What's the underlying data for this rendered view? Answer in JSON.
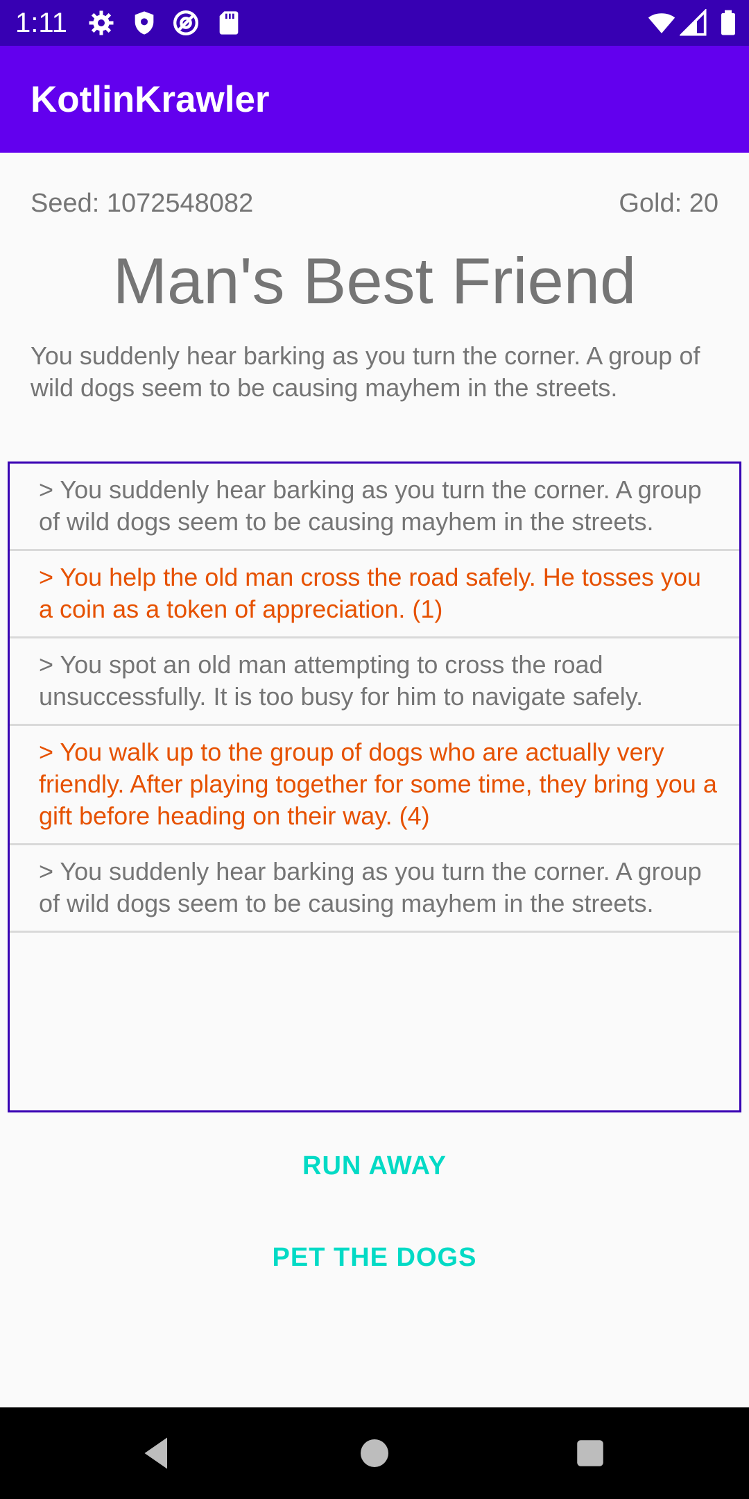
{
  "status_bar": {
    "time": "1:11",
    "icons": [
      "gear-icon",
      "shield-icon",
      "at-sign-icon",
      "sd-card-icon",
      "wifi-icon",
      "cell-signal-icon",
      "battery-icon"
    ]
  },
  "app_bar": {
    "title": "KotlinKrawler",
    "color": "#6200ee"
  },
  "header": {
    "seed": "Seed: 1072548082",
    "gold": "Gold: 20"
  },
  "event": {
    "title": "Man's Best Friend",
    "description": "You suddenly hear barking as you turn the corner. A group of wild dogs seem to be causing mayhem in the streets."
  },
  "log": [
    {
      "text": "> You suddenly hear barking as you turn the corner. A group of wild dogs seem to be causing mayhem in the streets.",
      "highlight": false
    },
    {
      "text": "> You help the old man cross the road safely. He tosses you a coin as a token of appreciation. (1)",
      "highlight": true
    },
    {
      "text": "> You spot an old man attempting to cross the road unsuccessfully. It is too busy for him to navigate safely.",
      "highlight": false
    },
    {
      "text": "> You walk up to the group of dogs who are actually very friendly. After playing together for some time, they bring you a gift before heading on their way. (4)",
      "highlight": true
    },
    {
      "text": "> You suddenly hear barking as you turn the corner. A group of wild dogs seem to be causing mayhem in the streets.",
      "highlight": false
    }
  ],
  "actions": {
    "run_away": "RUN AWAY",
    "pet_dogs": "PET THE DOGS"
  },
  "colors": {
    "status_bar": "#3700b3",
    "app_bar": "#6200ee",
    "accent": "#03dac5",
    "highlight_text": "#e65100",
    "log_border": "#3700b3"
  },
  "nav_bar": {
    "icons": [
      "back-icon",
      "home-icon",
      "recents-icon"
    ]
  }
}
